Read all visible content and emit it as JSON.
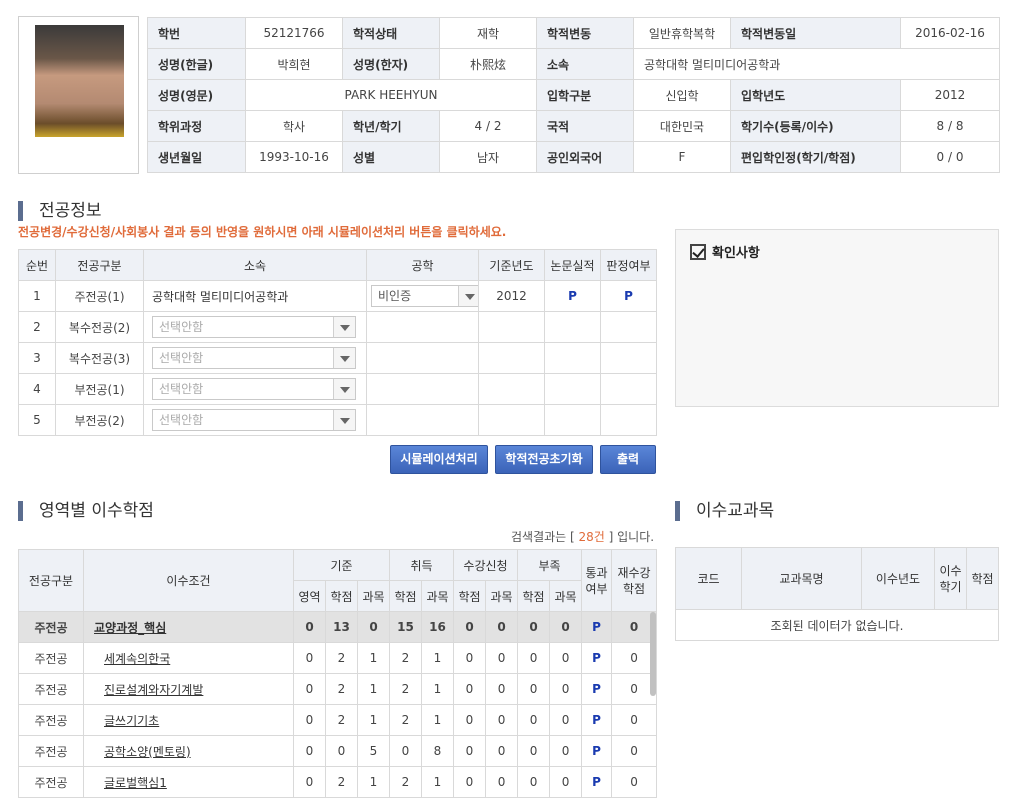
{
  "student": {
    "rows": [
      [
        {
          "l": "학번"
        },
        {
          "v": "52121766"
        },
        {
          "l": "학적상태"
        },
        {
          "v": "재학"
        },
        {
          "l": "학적변동"
        },
        {
          "v": "일반휴학복학"
        },
        {
          "l": "학적변동일"
        },
        {
          "v": "2016-02-16"
        }
      ],
      [
        {
          "l": "성명(한글)"
        },
        {
          "v": "박희현"
        },
        {
          "l": "성명(한자)"
        },
        {
          "v": "朴熙炫"
        },
        {
          "l": "소속"
        },
        {
          "v": "공학대학 멀티미디어공학과",
          "span": 3
        }
      ],
      [
        {
          "l": "성명(영문)"
        },
        {
          "v": "PARK HEEHYUN",
          "span": 3
        },
        {
          "l": "입학구분"
        },
        {
          "v": "신입학"
        },
        {
          "l": "입학년도"
        },
        {
          "v": "2012"
        }
      ],
      [
        {
          "l": "학위과정"
        },
        {
          "v": "학사"
        },
        {
          "l": "학년/학기"
        },
        {
          "v": "4 / 2"
        },
        {
          "l": "국적"
        },
        {
          "v": "대한민국"
        },
        {
          "l": "학기수(등록/이수)"
        },
        {
          "v": "8 / 8"
        }
      ],
      [
        {
          "l": "생년월일"
        },
        {
          "v": "1993-10-16"
        },
        {
          "l": "성별"
        },
        {
          "v": "남자"
        },
        {
          "l": "공인외국어"
        },
        {
          "v": "F"
        },
        {
          "l": "편입학인정(학기/학점)"
        },
        {
          "v": "0 / 0"
        }
      ]
    ]
  },
  "major": {
    "title": "전공정보",
    "notice": "전공변경/수강신청/사회봉사 결과 등의 반영을 원하시면 아래 시뮬레이션처리 버튼을 클릭하세요.",
    "headers": [
      "순번",
      "전공구분",
      "소속",
      "공학",
      "기준년도",
      "논문실적",
      "판정여부"
    ],
    "rows": [
      {
        "no": "1",
        "type": "주전공(1)",
        "dept": "공학대학 멀티미디어공학과",
        "eng": "비인증",
        "year": "2012",
        "thesis": "P",
        "judge": "P"
      },
      {
        "no": "2",
        "type": "복수전공(2)",
        "dept_select": "선택안함"
      },
      {
        "no": "3",
        "type": "복수전공(3)",
        "dept_select": "선택안함"
      },
      {
        "no": "4",
        "type": "부전공(1)",
        "dept_select": "선택안함"
      },
      {
        "no": "5",
        "type": "부전공(2)",
        "dept_select": "선택안함"
      }
    ],
    "buttons": [
      "시뮬레이션처리",
      "학적전공초기화",
      "출력"
    ]
  },
  "confirm": {
    "title": "확인사항"
  },
  "credits": {
    "title": "영역별 이수학점",
    "result_prefix": "검색결과는 [ ",
    "result_count": "28건",
    "result_suffix": " ] 입니다.",
    "h_type": "전공구분",
    "h_cond": "이수조건",
    "h_base": "기준",
    "h_earn": "취득",
    "h_reg": "수강신청",
    "h_lack": "부족",
    "h_pass": "통과여부",
    "h_retake": "재수강학점",
    "sub": [
      "영역",
      "학점",
      "과목",
      "학점",
      "과목",
      "학점",
      "과목",
      "학점",
      "과목"
    ],
    "rows": [
      {
        "t": "주전공",
        "c": "교양과정_핵심",
        "v": [
          "0",
          "13",
          "0",
          "15",
          "16",
          "0",
          "0",
          "0",
          "0"
        ],
        "p": "P",
        "r": "0",
        "hl": true
      },
      {
        "t": "주전공",
        "c": "세계속의한국",
        "v": [
          "0",
          "2",
          "1",
          "2",
          "1",
          "0",
          "0",
          "0",
          "0"
        ],
        "p": "P",
        "r": "0"
      },
      {
        "t": "주전공",
        "c": "진로설계와자기계발",
        "v": [
          "0",
          "2",
          "1",
          "2",
          "1",
          "0",
          "0",
          "0",
          "0"
        ],
        "p": "P",
        "r": "0"
      },
      {
        "t": "주전공",
        "c": "글쓰기기초",
        "v": [
          "0",
          "2",
          "1",
          "2",
          "1",
          "0",
          "0",
          "0",
          "0"
        ],
        "p": "P",
        "r": "0"
      },
      {
        "t": "주전공",
        "c": "공학소양(멘토링)",
        "v": [
          "0",
          "0",
          "5",
          "0",
          "8",
          "0",
          "0",
          "0",
          "0"
        ],
        "p": "P",
        "r": "0"
      },
      {
        "t": "주전공",
        "c": "글로벌핵심1",
        "v": [
          "0",
          "2",
          "1",
          "2",
          "1",
          "0",
          "0",
          "0",
          "0"
        ],
        "p": "P",
        "r": "0"
      }
    ]
  },
  "courses": {
    "title": "이수교과목",
    "headers": [
      "코드",
      "교과목명",
      "이수년도",
      "이수학기",
      "학점"
    ],
    "empty": "조회된 데이터가 없습니다."
  }
}
